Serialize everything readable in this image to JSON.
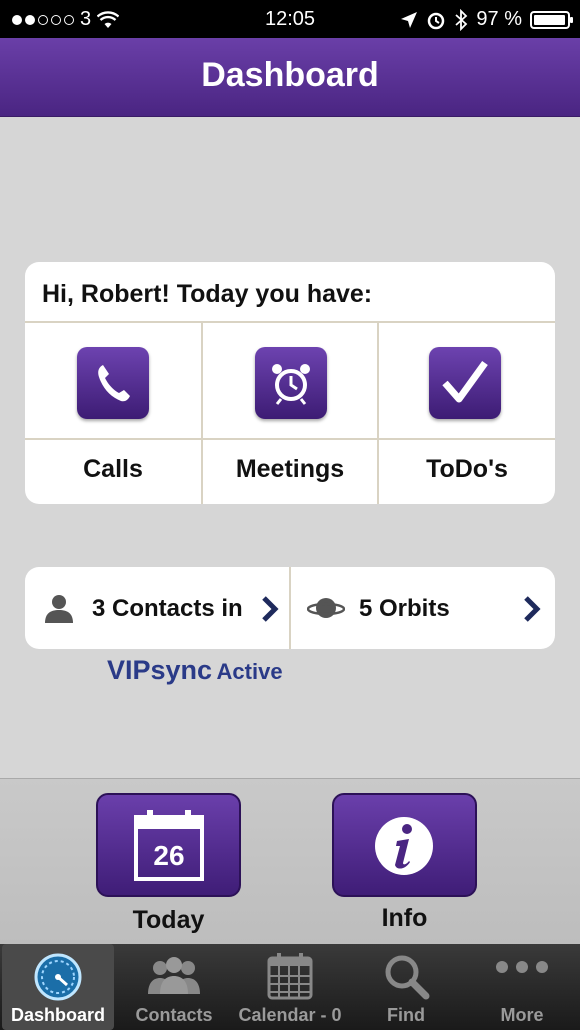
{
  "status_bar": {
    "carrier": "3",
    "time": "12:05",
    "battery": "97 %",
    "battery_level": 0.97
  },
  "nav": {
    "title": "Dashboard"
  },
  "summary": {
    "greeting": "Hi, Robert! Today you have:",
    "tiles": [
      {
        "label": "Calls",
        "icon": "phone-icon"
      },
      {
        "label": "Meetings",
        "icon": "alarm-clock-icon"
      },
      {
        "label": "ToDo's",
        "icon": "checkmark-icon"
      }
    ]
  },
  "links": {
    "contacts": "3 Contacts in",
    "orbits": "5 Orbits"
  },
  "vipsync": {
    "name": "VIPsync",
    "state": "Active"
  },
  "quick": {
    "today_label": "Today",
    "today_date": "26",
    "info_label": "Info"
  },
  "tabbar": {
    "items": [
      {
        "label": "Dashboard",
        "icon": "speedometer-icon",
        "selected": true
      },
      {
        "label": "Contacts",
        "icon": "people-icon",
        "selected": false
      },
      {
        "label": "Calendar - 0",
        "icon": "calendar-icon",
        "selected": false
      },
      {
        "label": "Find",
        "icon": "magnifier-icon",
        "selected": false
      },
      {
        "label": "More",
        "icon": "more-dots-icon",
        "selected": false
      }
    ]
  },
  "colors": {
    "accent": "#5a2f96",
    "link": "#2a3a88"
  }
}
